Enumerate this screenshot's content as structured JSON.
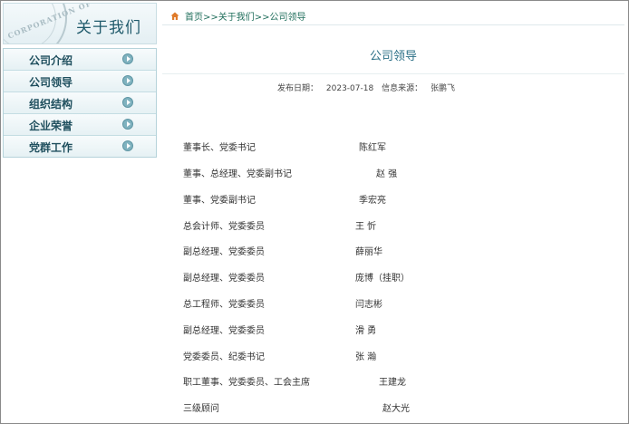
{
  "brand": {
    "seal_text": "CORPORATION OF",
    "title": "关于我们"
  },
  "sidebar": {
    "items": [
      {
        "label": "公司介绍"
      },
      {
        "label": "公司领导"
      },
      {
        "label": "组织结构"
      },
      {
        "label": "企业荣誉"
      },
      {
        "label": "党群工作"
      }
    ]
  },
  "breadcrumb": {
    "icon": "home-icon",
    "text": "首页>>关于我们>>公司领导"
  },
  "article": {
    "title": "公司领导",
    "publish_label": "发布日期：",
    "publish_date": "2023-07-18",
    "source_label": "信息来源：",
    "source": "张鹏飞"
  },
  "leaders": [
    {
      "role": "董事长、党委书记",
      "name": "陈红军"
    },
    {
      "role": "董事、总经理、党委副书记",
      "name": "赵 强"
    },
    {
      "role": "董事、党委副书记",
      "name": "季宏亮"
    },
    {
      "role": "总会计师、党委委员",
      "name": "王 忻"
    },
    {
      "role": "副总经理、党委委员",
      "name": "薛丽华"
    },
    {
      "role": "副总经理、党委委员",
      "name": "庞博（挂职）"
    },
    {
      "role": "总工程师、党委委员",
      "name": "闫志彬"
    },
    {
      "role": "副总经理、党委委员",
      "name": "滑 勇"
    },
    {
      "role": "党委委员、纪委书记",
      "name": "张 瀚"
    },
    {
      "role": "职工董事、党委委员、工会主席",
      "name": "王建龙"
    },
    {
      "role": "三级顾问",
      "name": "赵大光"
    }
  ],
  "colors": {
    "accent": "#2b6f86",
    "menu_text": "#1f4f5e",
    "breadcrumb_text": "#1f6e5b",
    "home_icon": "#e07b2a"
  }
}
